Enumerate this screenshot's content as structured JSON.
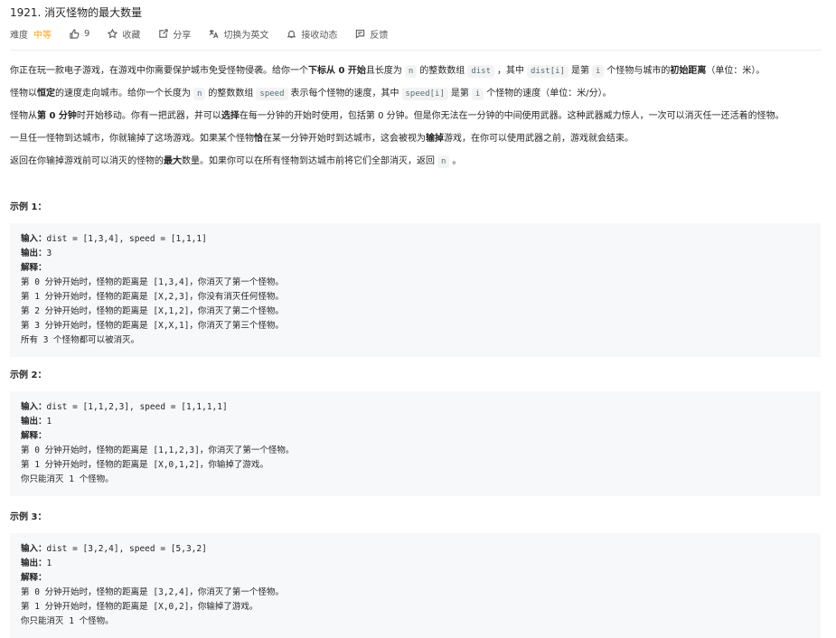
{
  "problem": {
    "title": "1921. 消灭怪物的最大数量",
    "difficulty_label": "难度",
    "difficulty": "中等",
    "likes": "9",
    "favorite": "收藏",
    "share": "分享",
    "switch_lang": "切换为英文",
    "notify": "接收动态",
    "feedback": "反馈",
    "accent_color": "#ffa116"
  },
  "desc": {
    "p1": {
      "a": "你正在玩一款电子游戏，在游戏中你需要保护城市免受怪物侵袭。给你一个 ",
      "b": "下标从 0 开始",
      "c": " 且长度为 ",
      "code1": "n",
      "d": " 的整数数组 ",
      "code2": "dist",
      "e": " ，其中 ",
      "code3": "dist[i]",
      "f": " 是第 ",
      "code4": "i",
      "g": " 个怪物与城市的 ",
      "h": "初始距离",
      "i": "（单位：米）。"
    },
    "p2": {
      "a": "怪物以 ",
      "b": "恒定",
      "c": " 的速度走向城市。给你一个长度为 ",
      "code1": "n",
      "d": " 的整数数组 ",
      "code2": "speed",
      "e": " 表示每个怪物的速度，其中 ",
      "code3": "speed[i]",
      "f": " 是第 ",
      "code4": "i",
      "g": " 个怪物的速度（单位：米/分）。"
    },
    "p3": {
      "a": "怪物从 ",
      "b": "第 0 分钟",
      "c": " 时开始移动。你有一把武器，并可以 ",
      "d": "选择",
      "e": " 在每一分钟的开始时使用，包括第 0 分钟。但是你无法在一分钟的中间使用武器。这种武器威力惊人，一次可以消灭任一还活着的怪物。"
    },
    "p4": {
      "a": "一旦任一怪物到达城市，你就输掉了这场游戏。如果某个怪物 ",
      "b": "恰",
      "c": " 在某一分钟开始时到达城市，这会被视为 ",
      "d": "输掉",
      "e": " 游戏，在你可以使用武器之前，游戏就会结束。"
    },
    "p5": {
      "a": "返回在你输掉游戏前可以消灭的怪物的 ",
      "b": "最大",
      "c": " 数量。如果你可以在所有怪物到达城市前将它们全部消灭，返回  ",
      "code1": "n",
      "d": " 。"
    }
  },
  "examples": [
    {
      "heading": "示例 1：",
      "input_label": "输入：",
      "input": "dist = [1,3,4], speed = [1,1,1]",
      "output_label": "输出：",
      "output": "3",
      "explain_label": "解释：",
      "lines": [
        "第 0 分钟开始时，怪物的距离是 [1,3,4]，你消灭了第一个怪物。",
        "第 1 分钟开始时，怪物的距离是 [X,2,3]，你没有消灭任何怪物。",
        "第 2 分钟开始时，怪物的距离是 [X,1,2]，你消灭了第二个怪物。",
        "第 3 分钟开始时，怪物的距离是 [X,X,1]，你消灭了第三个怪物。",
        "所有 3 个怪物都可以被消灭。"
      ]
    },
    {
      "heading": "示例 2：",
      "input_label": "输入：",
      "input": "dist = [1,1,2,3], speed = [1,1,1,1]",
      "output_label": "输出：",
      "output": "1",
      "explain_label": "解释：",
      "lines": [
        "第 0 分钟开始时，怪物的距离是 [1,1,2,3]，你消灭了第一个怪物。",
        "第 1 分钟开始时，怪物的距离是 [X,0,1,2]，你输掉了游戏。",
        "你只能消灭 1 个怪物。"
      ]
    },
    {
      "heading": "示例 3：",
      "input_label": "输入：",
      "input": "dist = [3,2,4], speed = [5,3,2]",
      "output_label": "输出：",
      "output": "1",
      "explain_label": "解释：",
      "lines": [
        "第 0 分钟开始时，怪物的距离是 [3,2,4]，你消灭了第一个怪物。",
        "第 1 分钟开始时，怪物的距离是 [X,0,2]，你输掉了游戏。",
        "你只能消灭 1 个怪物。"
      ]
    }
  ]
}
